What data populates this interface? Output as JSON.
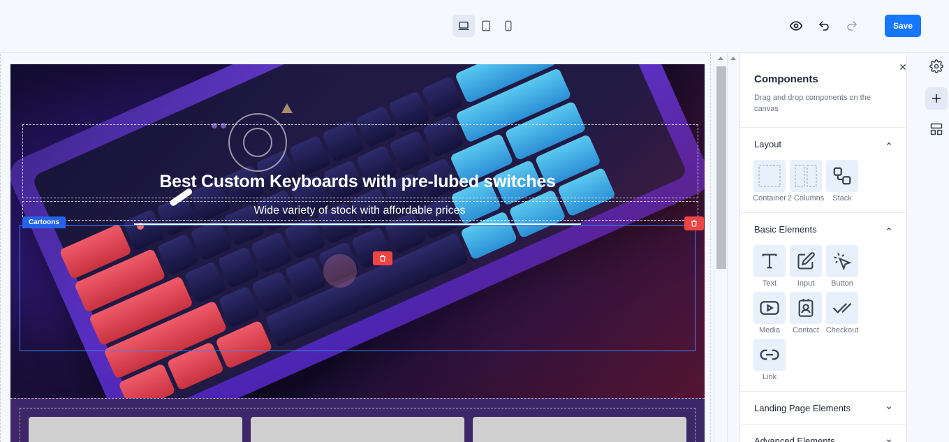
{
  "toolbar": {
    "devices": [
      {
        "name": "desktop",
        "icon": "laptop-icon",
        "active": true
      },
      {
        "name": "tablet",
        "icon": "tablet-icon",
        "active": false
      },
      {
        "name": "mobile",
        "icon": "mobile-icon",
        "active": false
      }
    ],
    "preview_icon": "eye-icon",
    "undo_icon": "undo-icon",
    "redo_icon": "redo-icon",
    "save_label": "Save",
    "accent": "#1677ff"
  },
  "canvas": {
    "hero": {
      "title": "Best Custom Keyboards with pre-lubed switches",
      "subtitle": "Wide variety of stock with affordable prices",
      "selected_tag": "Cartoons",
      "delete_color": "#ef4444"
    }
  },
  "panel": {
    "title": "Components",
    "description": "Drag and drop components on the canvas",
    "sections": [
      {
        "title": "Layout",
        "expanded": true,
        "items": [
          {
            "label": "Container",
            "icon": "container-icon"
          },
          {
            "label": "2 Columns",
            "icon": "columns-icon"
          },
          {
            "label": "Stack",
            "icon": "stack-icon"
          }
        ]
      },
      {
        "title": "Basic Elements",
        "expanded": true,
        "items": [
          {
            "label": "Text",
            "icon": "text-icon"
          },
          {
            "label": "Input",
            "icon": "input-icon"
          },
          {
            "label": "Button",
            "icon": "button-icon"
          },
          {
            "label": "Media",
            "icon": "media-icon"
          },
          {
            "label": "Contact",
            "icon": "contact-icon"
          },
          {
            "label": "Checkout",
            "icon": "checkout-icon"
          },
          {
            "label": "Link",
            "icon": "link-icon"
          }
        ]
      },
      {
        "title": "Landing Page Elements",
        "expanded": false
      },
      {
        "title": "Advanced Elements",
        "expanded": false
      }
    ]
  },
  "rail": [
    "settings-icon",
    "plus-icon",
    "layout-icon"
  ]
}
